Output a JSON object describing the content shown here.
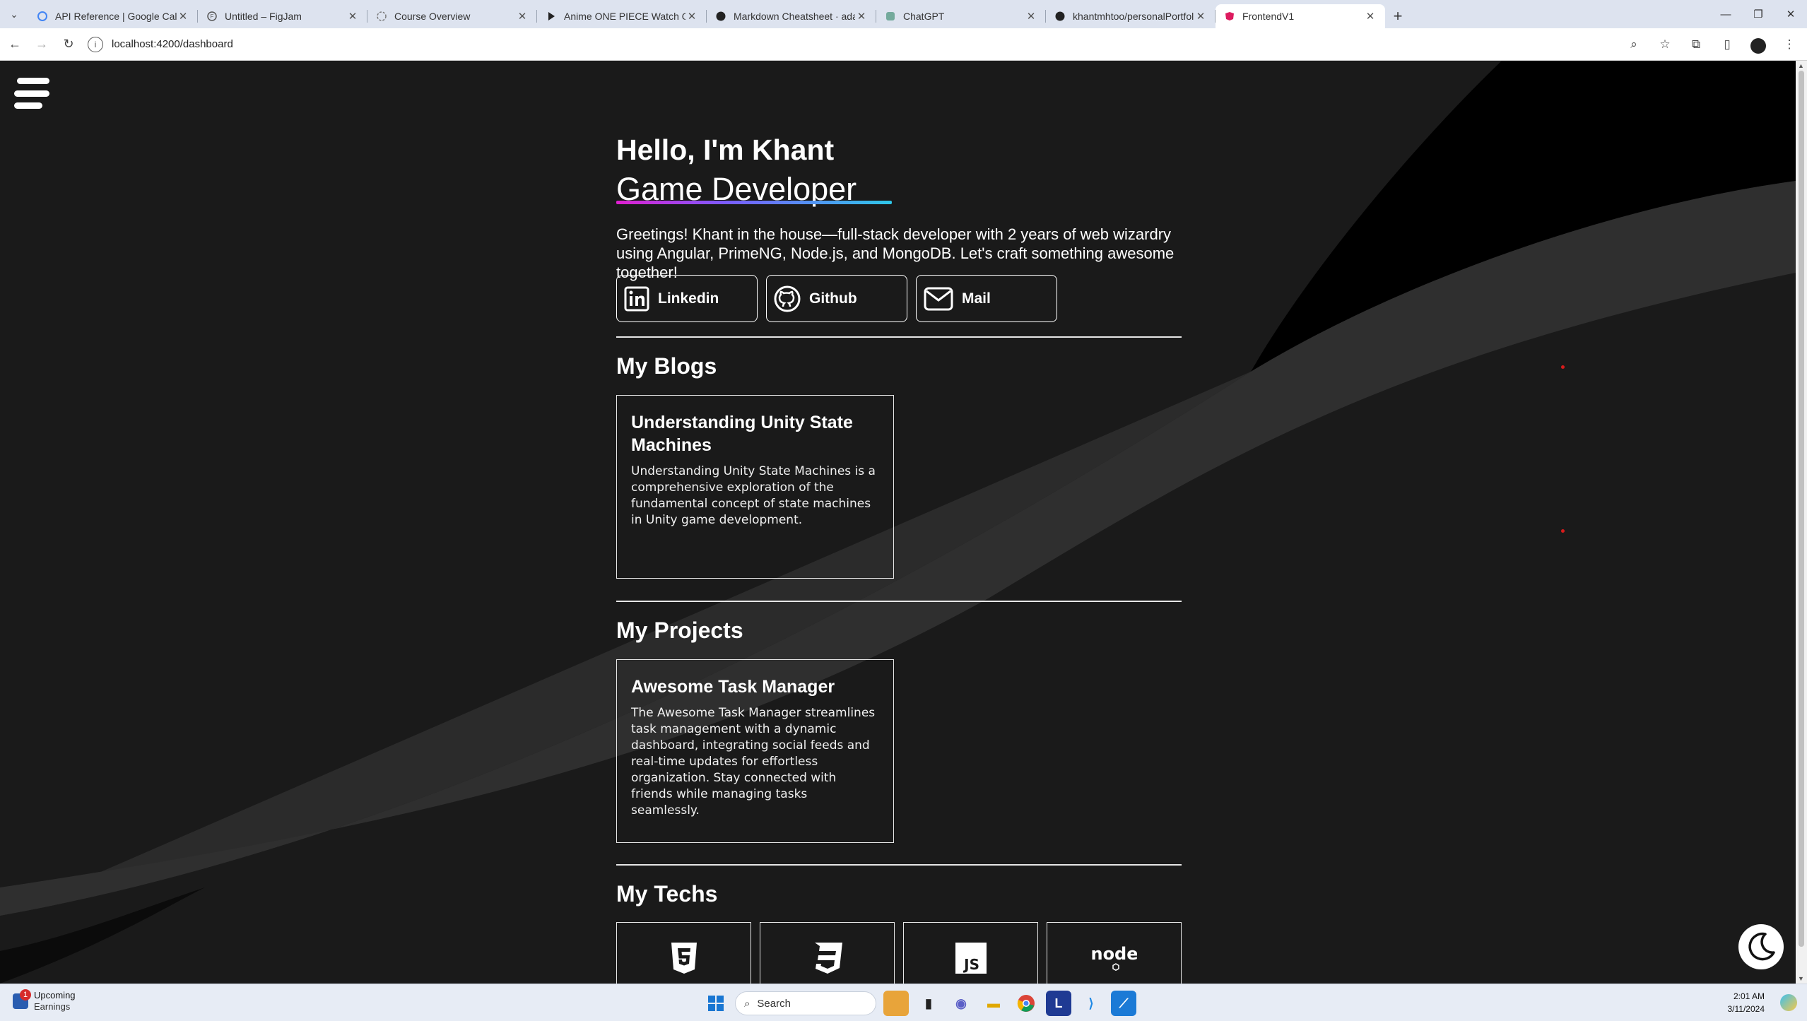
{
  "browser": {
    "tabs": [
      {
        "title": "API Reference  |  Google Calend",
        "favicon": "google-icon",
        "active": false
      },
      {
        "title": "Untitled – FigJam",
        "favicon": "figma-icon",
        "active": false
      },
      {
        "title": "Course Overview",
        "favicon": "globe-icon",
        "active": false
      },
      {
        "title": "Anime ONE PIECE Watch Online",
        "favicon": "play-icon",
        "active": false
      },
      {
        "title": "Markdown Cheatsheet · adam-p",
        "favicon": "github-icon",
        "active": false
      },
      {
        "title": "ChatGPT",
        "favicon": "chatgpt-icon",
        "active": false
      },
      {
        "title": "khantmhtoo/personalPortfolio",
        "favicon": "github-icon",
        "active": false
      },
      {
        "title": "FrontendV1",
        "favicon": "angular-icon",
        "active": true
      }
    ],
    "new_tab": "+",
    "url": "localhost:4200/dashboard"
  },
  "hero": {
    "greeting": "Hello, I'm Khant",
    "role": "Game Developer",
    "intro": "Greetings! Khant in the house—full-stack developer with 2 years of web wizardry using Angular, PrimeNG, Node.js, and MongoDB. Let's craft something awesome together!"
  },
  "social": {
    "linkedin": "Linkedin",
    "github": "Github",
    "mail": "Mail"
  },
  "blogs": {
    "title": "My Blogs",
    "items": [
      {
        "title": "Understanding Unity State Machines",
        "description": "Understanding Unity State Machines is a comprehensive exploration of the fundamental concept of state machines in Unity game development."
      }
    ]
  },
  "projects": {
    "title": "My Projects",
    "items": [
      {
        "title": "Awesome Task Manager",
        "description": "The Awesome Task Manager streamlines task management with a dynamic dashboard, integrating social feeds and real-time updates for effortless organization. Stay connected with friends while managing tasks seamlessly."
      }
    ]
  },
  "techs": {
    "title": "My Techs",
    "items": [
      "html5-icon",
      "css3-icon",
      "javascript-icon",
      "nodejs-icon"
    ]
  },
  "taskbar": {
    "widget_badge": "1",
    "widget_title": "Upcoming",
    "widget_subtitle": "Earnings",
    "search_placeholder": "Search",
    "time": "2:01 AM",
    "date": "3/11/2024"
  },
  "colors": {
    "page_bg": "#1a1a1a",
    "text": "#ffffff",
    "accent_gradient_start": "#e01fcf",
    "accent_gradient_end": "#2ec7e8"
  }
}
